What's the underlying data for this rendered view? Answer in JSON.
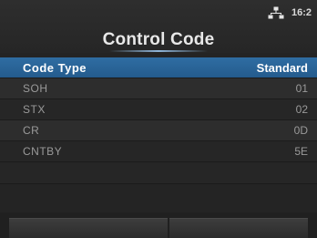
{
  "header": {
    "title": "Control Code",
    "time": "16:2",
    "network_icon": "network-icon"
  },
  "list": {
    "selected": {
      "label": "Code Type",
      "value": "Standard"
    },
    "items": [
      {
        "label": "SOH",
        "value": "01"
      },
      {
        "label": "STX",
        "value": "02"
      },
      {
        "label": "CR",
        "value": "0D"
      },
      {
        "label": "CNTBY",
        "value": "5E"
      }
    ]
  },
  "colors": {
    "selection": "#2f6da3",
    "background": "#242424",
    "text": "#9a9a9a"
  }
}
